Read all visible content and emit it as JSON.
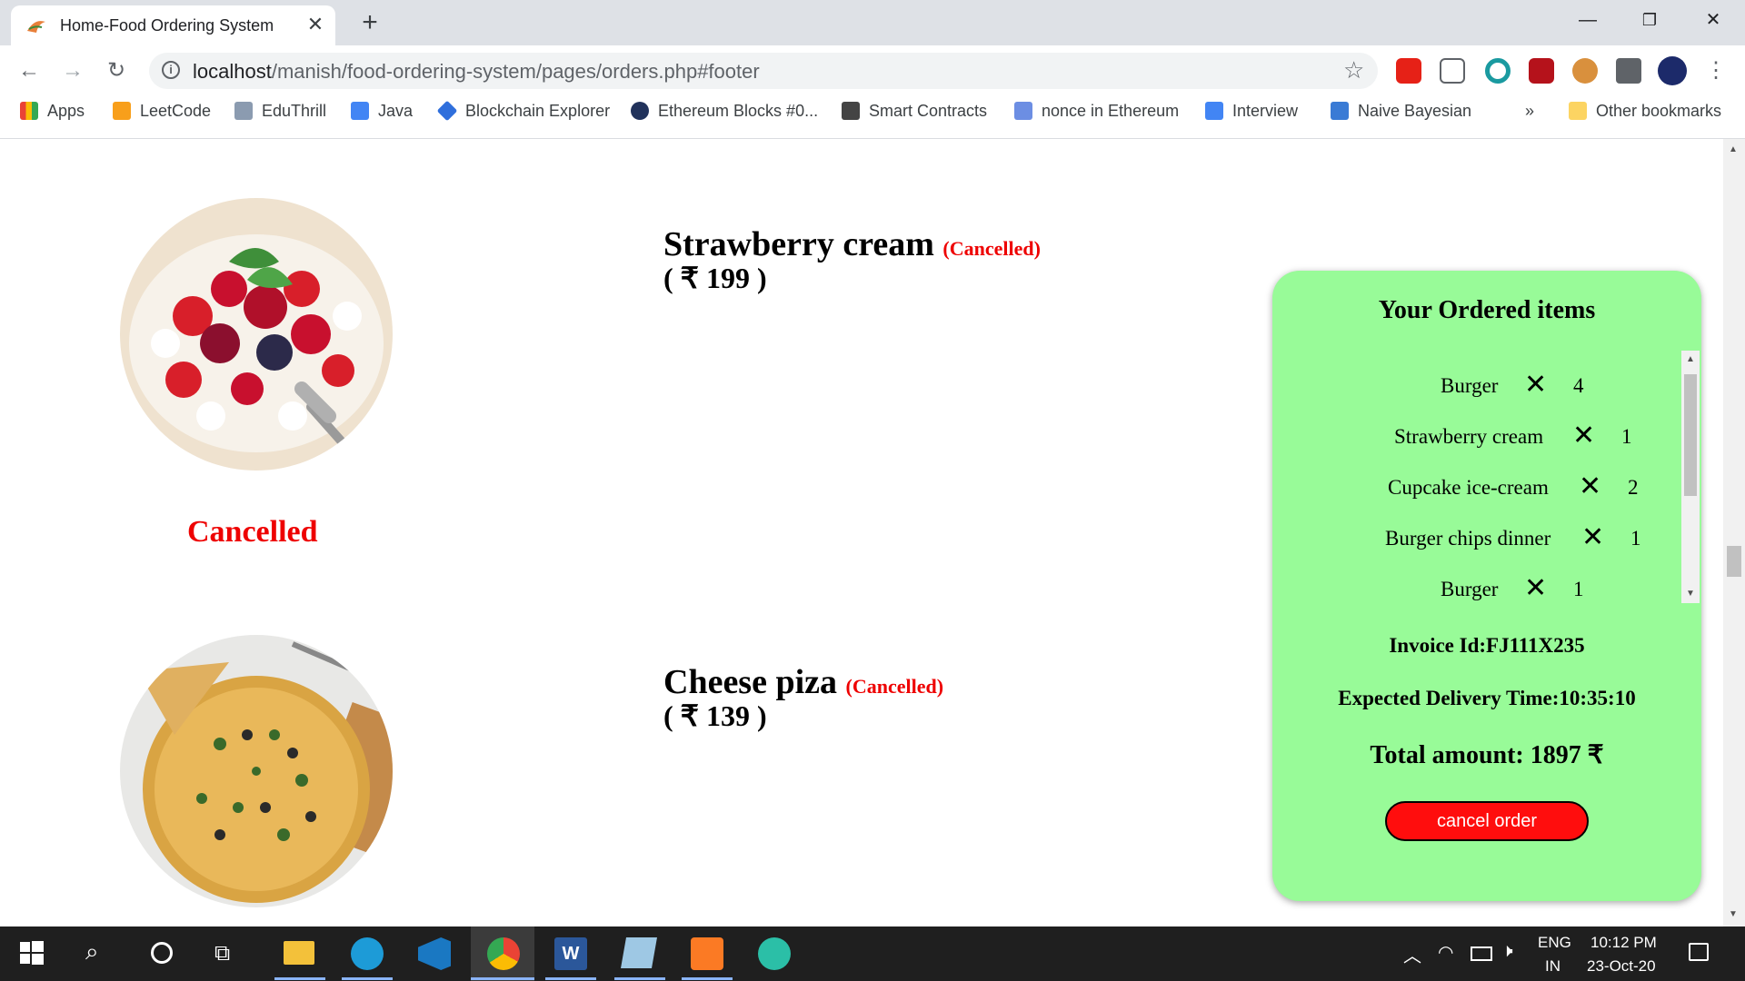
{
  "browser": {
    "tab_title": "Home-Food Ordering System",
    "url_host": "localhost",
    "url_path": "/manish/food-ordering-system/pages/orders.php#footer",
    "bookmarks": [
      {
        "label": "Apps"
      },
      {
        "label": "LeetCode"
      },
      {
        "label": "EduThrill"
      },
      {
        "label": "Java"
      },
      {
        "label": "Blockchain Explorer"
      },
      {
        "label": "Ethereum Blocks #0..."
      },
      {
        "label": "Smart Contracts"
      },
      {
        "label": "nonce in Ethereum"
      },
      {
        "label": "Interview"
      },
      {
        "label": "Naive Bayesian"
      }
    ],
    "overflow": "»",
    "other_bookmarks": "Other bookmarks"
  },
  "orders": [
    {
      "name": "Strawberry cream",
      "status": "(Cancelled)",
      "price": "( ₹ 199 )",
      "label": "Cancelled"
    },
    {
      "name": "Cheese piza",
      "status": "(Cancelled)",
      "price": "( ₹ 139 )"
    }
  ],
  "panel": {
    "title": "Your Ordered items",
    "items": [
      {
        "name": "Burger",
        "x": "✕",
        "qty": "4"
      },
      {
        "name": "Strawberry cream",
        "x": "✕",
        "qty": "1"
      },
      {
        "name": "Cupcake ice-cream",
        "x": "✕",
        "qty": "2"
      },
      {
        "name": "Burger chips dinner",
        "x": "✕",
        "qty": "1"
      },
      {
        "name": "Burger",
        "x": "✕",
        "qty": "1"
      }
    ],
    "invoice": "Invoice Id:FJ111X235",
    "delivery": "Expected Delivery Time:10:35:10",
    "total": "Total amount: 1897 ₹",
    "cancel_button": "cancel order"
  },
  "taskbar": {
    "lang_top": "ENG",
    "lang_bottom": "IN",
    "time": "10:12 PM",
    "date": "23-Oct-20"
  },
  "colors": {
    "panel_bg": "#98fb98",
    "cancel_red": "#e00000",
    "button_red": "#ff0d0d"
  }
}
